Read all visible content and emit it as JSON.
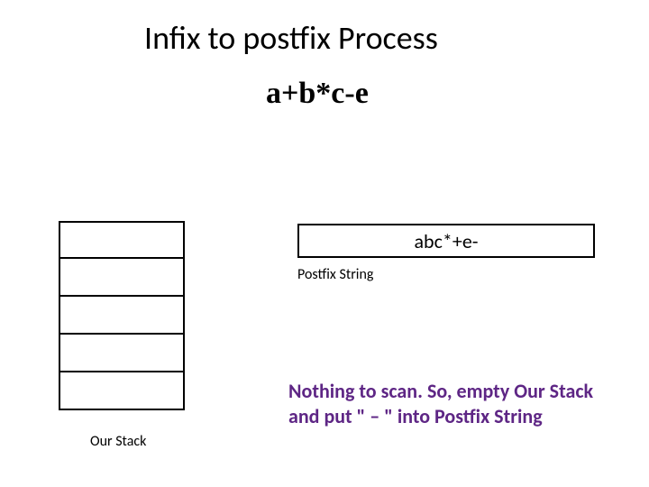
{
  "title": "Infix to postfix Process",
  "expression": "a+b*c-e",
  "postfix": {
    "value": "abc*+e-",
    "label": "Postfix String"
  },
  "stack": {
    "label": "Our Stack"
  },
  "explanation": "Nothing to scan. So, empty Our Stack and put \" – \" into Postfix String"
}
